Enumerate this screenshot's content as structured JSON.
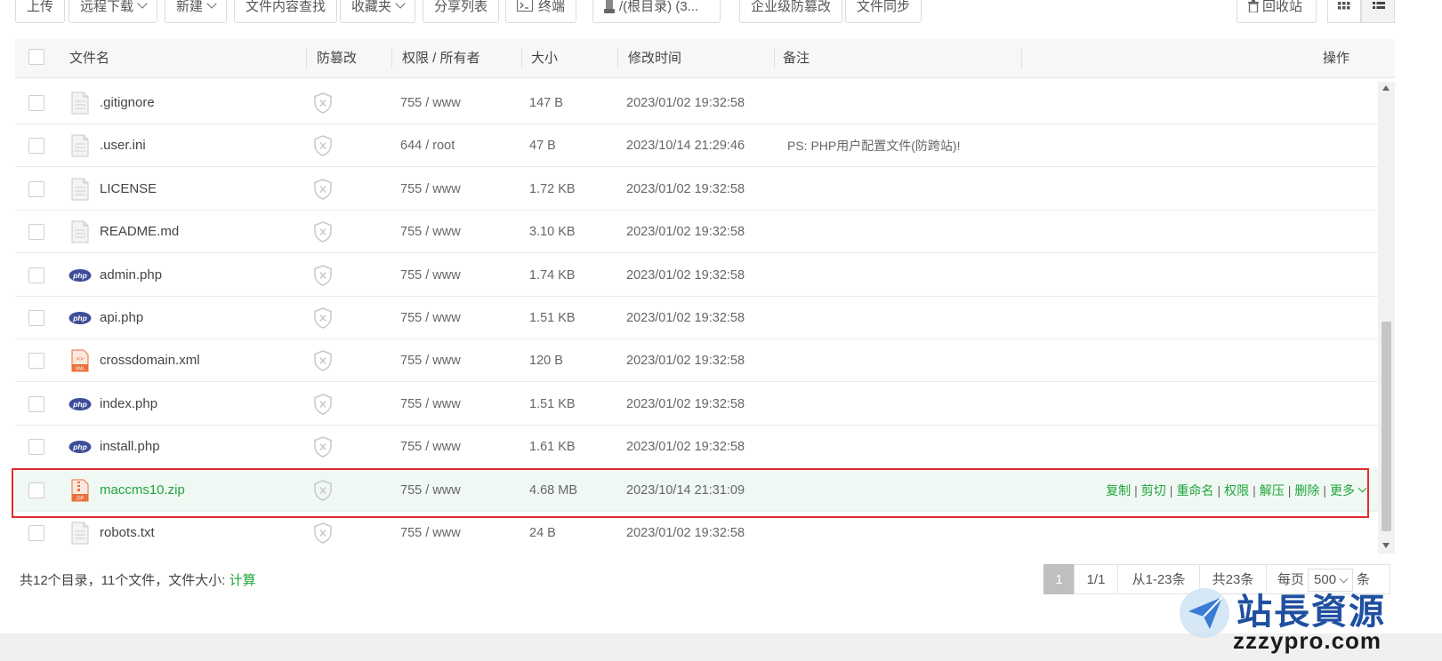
{
  "toolbar": {
    "upload": "上传",
    "remote_download": "远程下载",
    "new": "新建",
    "content_search": "文件内容查找",
    "favorites": "收藏夹",
    "share_list": "分享列表",
    "terminal": "终端",
    "disk": "/(根目录) (3...",
    "enterprise_tamper": "企业级防篡改",
    "file_sync": "文件同步",
    "recycle_bin": "回收站"
  },
  "table": {
    "headers": {
      "filename": "文件名",
      "tamper": "防篡改",
      "perm_owner": "权限 / 所有者",
      "size": "大小",
      "mtime": "修改时间",
      "note": "备注",
      "actions": "操作"
    },
    "rows": [
      {
        "name": ".gitignore",
        "icon": "text-file-icon",
        "perm": "755 / www",
        "size": "147 B",
        "mtime": "2023/01/02 19:32:58",
        "note": ""
      },
      {
        "name": ".user.ini",
        "icon": "text-file-icon",
        "perm": "644 / root",
        "size": "47 B",
        "mtime": "2023/10/14 21:29:46",
        "note": "PS: PHP用户配置文件(防跨站)!"
      },
      {
        "name": "LICENSE",
        "icon": "text-file-icon",
        "perm": "755 / www",
        "size": "1.72 KB",
        "mtime": "2023/01/02 19:32:58",
        "note": ""
      },
      {
        "name": "README.md",
        "icon": "text-file-icon",
        "perm": "755 / www",
        "size": "3.10 KB",
        "mtime": "2023/01/02 19:32:58",
        "note": ""
      },
      {
        "name": "admin.php",
        "icon": "php-file-icon",
        "perm": "755 / www",
        "size": "1.74 KB",
        "mtime": "2023/01/02 19:32:58",
        "note": ""
      },
      {
        "name": "api.php",
        "icon": "php-file-icon",
        "perm": "755 / www",
        "size": "1.51 KB",
        "mtime": "2023/01/02 19:32:58",
        "note": ""
      },
      {
        "name": "crossdomain.xml",
        "icon": "xml-file-icon",
        "perm": "755 / www",
        "size": "120 B",
        "mtime": "2023/01/02 19:32:58",
        "note": ""
      },
      {
        "name": "index.php",
        "icon": "php-file-icon",
        "perm": "755 / www",
        "size": "1.51 KB",
        "mtime": "2023/01/02 19:32:58",
        "note": ""
      },
      {
        "name": "install.php",
        "icon": "php-file-icon",
        "perm": "755 / www",
        "size": "1.61 KB",
        "mtime": "2023/01/02 19:32:58",
        "note": ""
      },
      {
        "name": "maccms10.zip",
        "icon": "zip-file-icon",
        "perm": "755 / www",
        "size": "4.68 MB",
        "mtime": "2023/10/14 21:31:09",
        "note": "",
        "selected": true
      },
      {
        "name": "robots.txt",
        "icon": "text-file-icon",
        "perm": "755 / www",
        "size": "24 B",
        "mtime": "2023/01/02 19:32:58",
        "note": ""
      }
    ],
    "row_actions": {
      "copy": "复制",
      "cut": "剪切",
      "rename": "重命名",
      "permission": "权限",
      "extract": "解压",
      "delete": "删除",
      "more": "更多"
    }
  },
  "footer": {
    "summary": "共12个目录，11个文件，文件大小:",
    "calc_link": "计算",
    "page_current": "1",
    "page_total": "1/1",
    "range": "从1-23条",
    "total_count": "共23条",
    "per_page_label": "每页",
    "per_page_value": "500",
    "per_page_unit": "条"
  },
  "watermark": {
    "title": "站長資源",
    "url": "zzzypro.com"
  },
  "colors": {
    "accent": "#20a53a",
    "highlight_border": "#e32b2b",
    "php_badge": "#3f4d99",
    "xml_icon": "#e8703a"
  }
}
